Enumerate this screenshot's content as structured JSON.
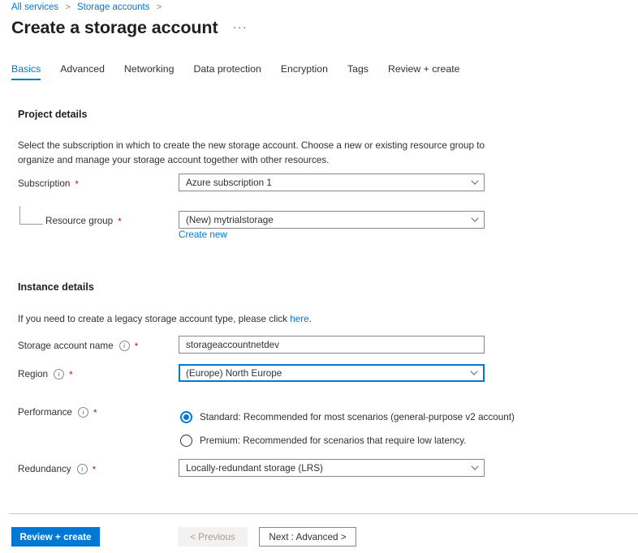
{
  "breadcrumb": {
    "items": [
      {
        "label": "All services",
        "link": true
      },
      {
        "label": "Storage accounts",
        "link": true
      }
    ],
    "separator": ">"
  },
  "header": {
    "title": "Create a storage account",
    "more_menu": "···"
  },
  "tabs": [
    {
      "label": "Basics",
      "active": true
    },
    {
      "label": "Advanced",
      "active": false
    },
    {
      "label": "Networking",
      "active": false
    },
    {
      "label": "Data protection",
      "active": false
    },
    {
      "label": "Encryption",
      "active": false
    },
    {
      "label": "Tags",
      "active": false
    },
    {
      "label": "Review + create",
      "active": false
    }
  ],
  "project_details": {
    "heading": "Project details",
    "description": "Select the subscription in which to create the new storage account. Choose a new or existing resource group to organize and manage your storage account together with other resources.",
    "subscription": {
      "label": "Subscription",
      "required": "*",
      "value": "Azure subscription 1"
    },
    "resource_group": {
      "label": "Resource group",
      "required": "*",
      "value": "(New) mytrialstorage",
      "create_new_link": "Create new"
    }
  },
  "instance_details": {
    "heading": "Instance details",
    "legacy_note_prefix": "If you need to create a legacy storage account type, please click ",
    "legacy_note_link": "here",
    "legacy_note_suffix": ".",
    "storage_account_name": {
      "label": "Storage account name",
      "required": "*",
      "value": "storageaccountnetdev",
      "placeholder": ""
    },
    "region": {
      "label": "Region",
      "required": "*",
      "value": "(Europe) North Europe"
    },
    "performance": {
      "label": "Performance",
      "required": "*",
      "options": [
        {
          "label": "Standard: Recommended for most scenarios (general-purpose v2 account)",
          "selected": true
        },
        {
          "label": "Premium: Recommended for scenarios that require low latency.",
          "selected": false
        }
      ]
    },
    "redundancy": {
      "label": "Redundancy",
      "required": "*",
      "value": "Locally-redundant storage (LRS)"
    }
  },
  "footer": {
    "review_create": "Review + create",
    "previous": "< Previous",
    "next": "Next : Advanced >"
  },
  "colors": {
    "accent": "#0078d4",
    "required_asterisk": "#a4262c",
    "text": "#323130",
    "border": "#8a8886",
    "disabled_bg": "#f3f2f1"
  }
}
